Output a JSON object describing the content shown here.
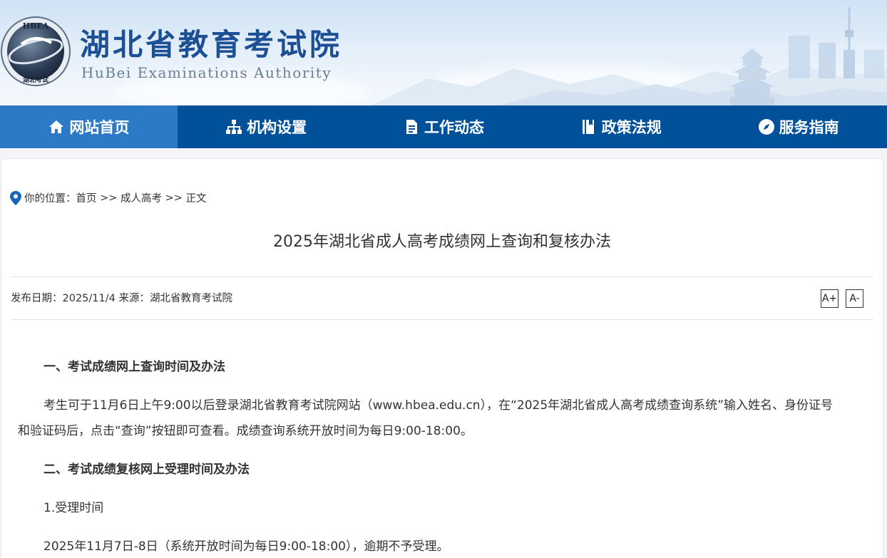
{
  "header": {
    "logo_text": "HBEA",
    "logo_subtext": "湖北考试",
    "title": "湖北省教育考试院",
    "subtitle": "HuBei Examinations Authority"
  },
  "nav": [
    {
      "label": "网站首页",
      "icon": "home-icon",
      "active": true
    },
    {
      "label": "机构设置",
      "icon": "sitemap-icon",
      "active": false
    },
    {
      "label": "工作动态",
      "icon": "document-icon",
      "active": false
    },
    {
      "label": "政策法规",
      "icon": "book-icon",
      "active": false
    },
    {
      "label": "服务指南",
      "icon": "compass-icon",
      "active": false
    }
  ],
  "breadcrumb": {
    "prefix": "你的位置：",
    "items": [
      "首页",
      "成人高考",
      "正文"
    ],
    "separator": ">>"
  },
  "article": {
    "title": "2025年湖北省成人高考成绩网上查询和复核办法",
    "date_label": "发布日期：",
    "date": "2025/11/4",
    "source_label": "来源：",
    "source": "湖北省教育考试院",
    "font_increase": "A+",
    "font_decrease": "A-",
    "section1_heading": "一、考试成绩网上查询时间及办法",
    "section1_para_line1": "考生可于11月6日上午9:00以后登录湖北省教育考试院网站（www.hbea.edu.cn），在“2025年湖北省成人高考成绩查询系统”输入姓名、身份证号",
    "section1_para_line2": "和验证码后，点击“查询”按钮即可查看。成绩查询系统开放时间为每日9:00-18:00。",
    "section2_heading": "二、考试成绩复核网上受理时间及办法",
    "section2_sub1": "1.受理时间",
    "section2_sub1_text": "2025年11月7日-8日（系统开放时间为每日9:00-18:00），逾期不予受理。"
  },
  "colors": {
    "nav_bg": "#00519a",
    "nav_active": "#2c79c6",
    "title_blue": "#1d4f95"
  }
}
